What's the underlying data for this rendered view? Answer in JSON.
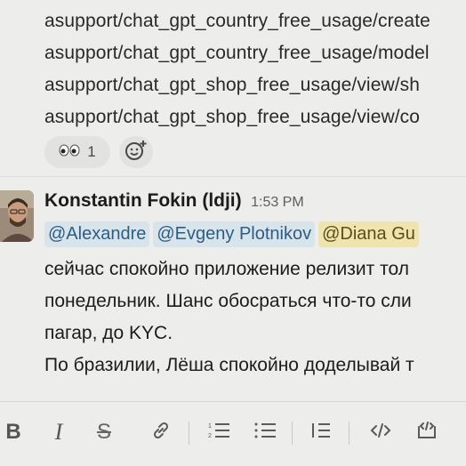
{
  "previous_message": {
    "lines": [
      "asupport/chat_gpt_country_free_usage/create",
      "asupport/chat_gpt_country_free_usage/model",
      "asupport/chat_gpt_shop_free_usage/view/sh",
      "asupport/chat_gpt_shop_free_usage/view/co"
    ],
    "reaction": {
      "emoji": "👀",
      "count": "1"
    },
    "add_reaction_icon": "add-emoji-icon"
  },
  "message": {
    "author": "Konstantin Fokin (ldji)",
    "time": "1:53 PM",
    "mentions": [
      "@Alexandre",
      "@Evgeny Plotnikov",
      "@Diana Gu"
    ],
    "lines": [
      "сейчас спокойно приложение релизит тол",
      "понедельник. Шанс обосраться что-то сли",
      "пагар, до KYC.",
      "По бразилии, Лёша спокойно доделывай т"
    ]
  },
  "toolbar": {
    "bold": "B",
    "italic": "I",
    "strike": "S",
    "items": [
      "bold-icon",
      "italic-icon",
      "strikethrough-icon",
      "link-icon",
      "ordered-list-icon",
      "bulleted-list-icon",
      "blockquote-icon",
      "code-icon",
      "code-block-icon"
    ]
  }
}
